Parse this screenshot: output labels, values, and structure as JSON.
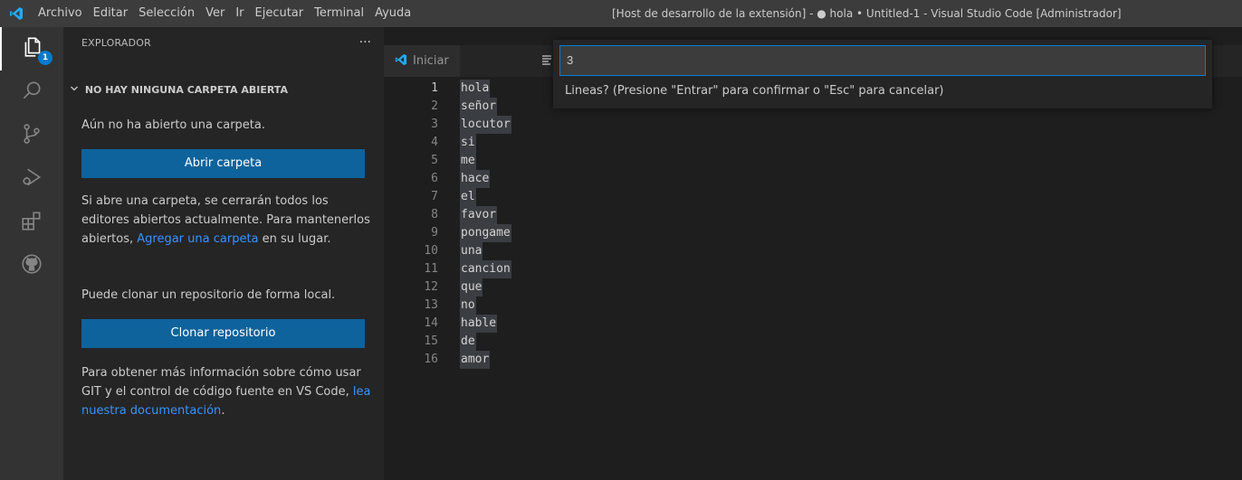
{
  "titlebar": {
    "menu": [
      "Archivo",
      "Editar",
      "Selección",
      "Ver",
      "Ir",
      "Ejecutar",
      "Terminal",
      "Ayuda"
    ],
    "window_title": "[Host de desarrollo de la extensión] - ● hola • Untitled-1 - Visual Studio Code [Administrador]",
    "logo_color": "#23a9f2"
  },
  "activitybar": {
    "badge": "1",
    "icons": [
      "files-icon",
      "search-icon",
      "source-control-icon",
      "run-debug-icon",
      "extensions-icon",
      "github-icon"
    ]
  },
  "sidebar": {
    "header": "EXPLORADOR",
    "more": "···",
    "section_title": "NO HAY NINGUNA CARPETA ABIERTA",
    "no_folder_text": "Aún no ha abierto una carpeta.",
    "open_folder_button": "Abrir carpeta",
    "info_text_1": "Si abre una carpeta, se cerrarán todos los editores abiertos actualmente. Para mantenerlos abiertos, ",
    "info_link_1": "Agregar una carpeta",
    "info_text_1b": " en su lugar.",
    "clone_text": "Puede clonar un repositorio de forma local.",
    "clone_button": "Clonar repositorio",
    "git_text": "Para obtener más información sobre cómo usar GIT y el control de código fuente en VS Code, ",
    "git_link": "lea nuestra documentación",
    "git_text_end": "."
  },
  "tabs": [
    {
      "label": "Iniciar"
    }
  ],
  "editor": {
    "lines": [
      "hola",
      "señor",
      "locutor",
      "si",
      "me",
      "hace",
      "el",
      "favor",
      "pongame",
      "una",
      "cancion",
      "que",
      "no",
      "hable",
      "de",
      "amor"
    ],
    "line_numbers": [
      "1",
      "2",
      "3",
      "4",
      "5",
      "6",
      "7",
      "8",
      "9",
      "10",
      "11",
      "12",
      "13",
      "14",
      "15",
      "16"
    ]
  },
  "quick_input": {
    "value": "3",
    "message": "Lineas? (Presione \"Entrar\" para confirmar o \"Esc\" para cancelar)"
  },
  "colors": {
    "accent": "#007acc",
    "button": "#0e639c",
    "link": "#3794ff"
  }
}
